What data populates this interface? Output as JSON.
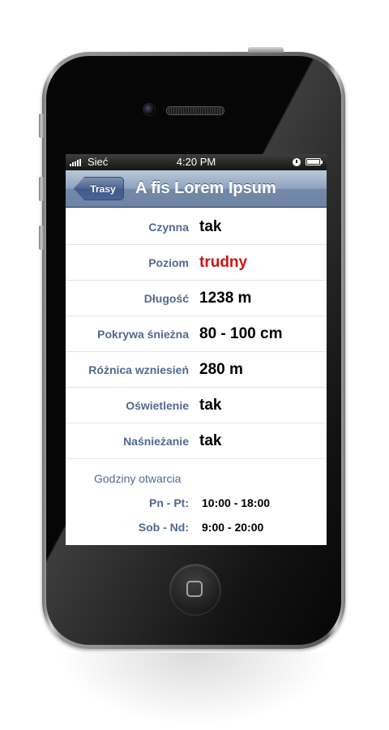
{
  "status_bar": {
    "carrier": "Sieć",
    "time": "4:20 PM"
  },
  "nav": {
    "back_label": "Trasy",
    "title": "A fis Lorem Ipsum"
  },
  "details": [
    {
      "label": "Czynna",
      "value": "tak"
    },
    {
      "label": "Poziom",
      "value": "trudny"
    },
    {
      "label": "Długość",
      "value": "1238 m"
    },
    {
      "label": "Pokrywa śnieżna",
      "value": "80 - 100 cm"
    },
    {
      "label": "Różnica wzniesień",
      "value": "280 m"
    },
    {
      "label": "Oświetlenie",
      "value": "tak"
    },
    {
      "label": "Naśnieżanie",
      "value": "tak"
    }
  ],
  "hours": {
    "title": "Godziny otwarcia",
    "rows": [
      {
        "label": "Pn - Pt:",
        "value": "10:00 - 18:00"
      },
      {
        "label": "Sob - Nd:",
        "value": "9:00 - 20:00"
      }
    ]
  },
  "colors": {
    "label": "#51698f",
    "danger": "#cc1414",
    "nav": "#7489a8"
  },
  "icons": [
    "signal-icon",
    "clock-icon",
    "battery-icon",
    "chevron-back-icon"
  ]
}
